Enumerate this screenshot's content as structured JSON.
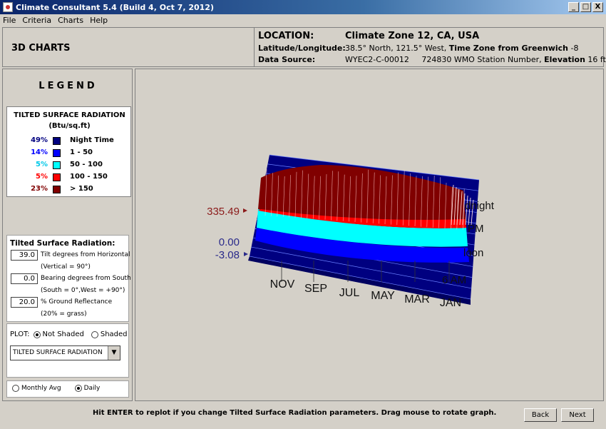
{
  "window": {
    "title": "Climate Consultant 5.4 (Build 4, Oct 7, 2012)",
    "controls": [
      "_",
      "□",
      "X"
    ]
  },
  "menu": [
    "File",
    "Criteria",
    "Charts",
    "Help"
  ],
  "header": {
    "section_title": "3D CHARTS",
    "location_label": "LOCATION:",
    "location_value": "Climate Zone 12, CA, USA",
    "latlon_label": "Latitude/Longitude:",
    "latlon_value": "38.5° North, 121.5° West,",
    "timezone_label": "Time Zone from Greenwich",
    "timezone_value": "-8",
    "source_label": "Data Source:",
    "source_id": "WYEC2-C-00012",
    "station_number": "724830 WMO Station Number,",
    "elevation_label": "Elevation",
    "elevation_value": "16 ft"
  },
  "legend": {
    "title": "LEGEND",
    "heading": "TILTED SURFACE RADIATION",
    "units": "(Btu/sq.ft)",
    "rows": [
      {
        "pct": "49%",
        "range": "Night Time",
        "color": "#000080",
        "text_color": "#000080"
      },
      {
        "pct": "14%",
        "range": "1    -    50",
        "color": "#0000ff",
        "text_color": "#0000ff"
      },
      {
        "pct": "5%",
        "range": "50   -   100",
        "color": "#00ffff",
        "text_color": "#00c8e8"
      },
      {
        "pct": "5%",
        "range": "100   -   150",
        "color": "#ff0000",
        "text_color": "#ff0000"
      },
      {
        "pct": "23%",
        "range": "> 150",
        "color": "#800000",
        "text_color": "#800000"
      }
    ]
  },
  "params": {
    "title": "Tilted Surface Radiation:",
    "tilt_value": "39.0",
    "tilt_label": "Tilt degrees from Horizontal",
    "tilt_note": "(Vertical = 90°)",
    "bearing_value": "0.0",
    "bearing_label": "Bearing degrees from South",
    "bearing_note": "(South = 0°,West = +90°)",
    "reflect_value": "20.0",
    "reflect_label": "% Ground Reflectance",
    "reflect_note": "(20% = grass)"
  },
  "plot": {
    "label": "PLOT:",
    "not_shaded": "Not Shaded",
    "shaded": "Shaded",
    "selected": "not_shaded",
    "dropdown_value": "TILTED SURFACE RADIATION"
  },
  "averaging": {
    "monthly": "Monthly Avg",
    "daily": "Daily",
    "selected": "daily"
  },
  "chart_data": {
    "type": "3d-surface",
    "z_labels": [
      "335.49",
      "0.00",
      "-3.08"
    ],
    "month_labels": [
      "NOV",
      "SEP",
      "JUL",
      "MAY",
      "MAR",
      "JAN"
    ],
    "hour_labels": [
      "dnight",
      "PM",
      "loon",
      "6 AM"
    ],
    "colors": {
      "night": "#000080",
      "low": "#0000ff",
      "mid": "#00ffff",
      "high": "#ff0000",
      "peak": "#800000"
    }
  },
  "footer": {
    "message": "Hit ENTER to replot if you change Tilted Surface Radiation parameters.   Drag mouse to rotate graph.",
    "back": "Back",
    "next": "Next"
  }
}
